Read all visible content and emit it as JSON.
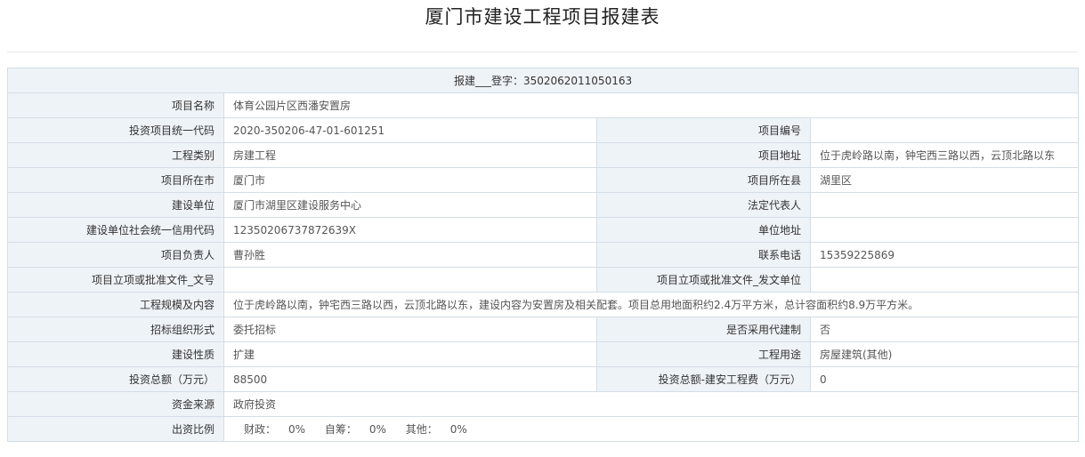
{
  "title": "厦门市建设工程项目报建表",
  "registration": {
    "label": "报建___登字：",
    "number": "3502062011050163"
  },
  "fields": {
    "project_name": {
      "label": "项目名称",
      "value": "体育公园片区西潘安置房"
    },
    "invest_code": {
      "label": "投资项目统一代码",
      "value": "2020-350206-47-01-601251"
    },
    "project_no": {
      "label": "项目编号",
      "value": ""
    },
    "project_category": {
      "label": "工程类别",
      "value": "房建工程"
    },
    "project_address": {
      "label": "项目地址",
      "value": "位于虎岭路以南，钟宅西三路以西，云顶北路以东"
    },
    "city": {
      "label": "项目所在市",
      "value": "厦门市"
    },
    "county": {
      "label": "项目所在县",
      "value": "湖里区"
    },
    "builder": {
      "label": "建设单位",
      "value": "厦门市湖里区建设服务中心"
    },
    "legal_rep": {
      "label": "法定代表人",
      "value": ""
    },
    "credit_code": {
      "label": "建设单位社会统一信用代码",
      "value": "12350206737872639X"
    },
    "unit_address": {
      "label": "单位地址",
      "value": ""
    },
    "person_in_charge": {
      "label": "项目负责人",
      "value": "曹孙胜"
    },
    "phone": {
      "label": "联系电话",
      "value": "15359225869"
    },
    "approval_doc_no": {
      "label": "项目立项或批准文件_文号",
      "value": ""
    },
    "approval_issuer": {
      "label": "项目立项或批准文件_发文单位",
      "value": ""
    },
    "scale": {
      "label": "工程规模及内容",
      "value": "位于虎岭路以南，钟宅西三路以西，云顶北路以东，建设内容为安置房及相关配套。项目总用地面积约2.4万平方米，总计容面积约8.9万平方米。"
    },
    "bidding_form": {
      "label": "招标组织形式",
      "value": "委托招标"
    },
    "agent_system": {
      "label": "是否采用代建制",
      "value": "否"
    },
    "nature": {
      "label": "建设性质",
      "value": "扩建"
    },
    "usage": {
      "label": "工程用途",
      "value": "房屋建筑(其他)"
    },
    "total_invest": {
      "label": "投资总额（万元）",
      "value": "88500"
    },
    "construction_cost": {
      "label": "投资总额-建安工程费（万元）",
      "value": "0"
    },
    "fund_source": {
      "label": "资金来源",
      "value": "政府投资"
    },
    "funding_ratio": {
      "label": "出资比例",
      "items": [
        {
          "key": "财政：",
          "value": "0%"
        },
        {
          "key": "自筹：",
          "value": "0%"
        },
        {
          "key": "其他：",
          "value": "0%"
        }
      ]
    }
  }
}
